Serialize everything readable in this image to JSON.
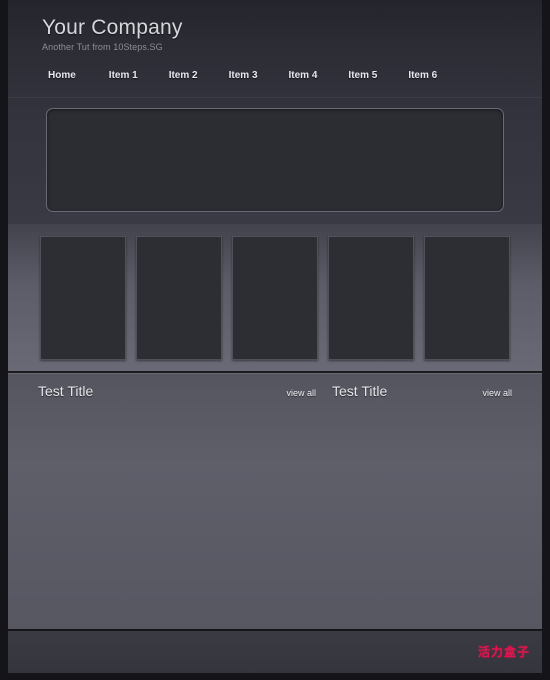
{
  "header": {
    "brand_title": "Your Company",
    "brand_tagline": "Another Tut from 10Steps.SG"
  },
  "nav": {
    "items": [
      {
        "label": "Home"
      },
      {
        "label": "Item 1"
      },
      {
        "label": "Item 2"
      },
      {
        "label": "Item 3"
      },
      {
        "label": "Item 4"
      },
      {
        "label": "Item 5"
      },
      {
        "label": "Item 6"
      }
    ]
  },
  "hero": {
    "placeholder_label": ""
  },
  "thumbnails": [
    {
      "label": ""
    },
    {
      "label": ""
    },
    {
      "label": ""
    },
    {
      "label": ""
    },
    {
      "label": ""
    }
  ],
  "panels": [
    {
      "title": "Test Title",
      "view_all_label": "view all",
      "body": ""
    },
    {
      "title": "Test Title",
      "view_all_label": "view all",
      "body": ""
    }
  ],
  "footer": {
    "watermark": "活力盒子"
  },
  "colors": {
    "header_bg": "#2c2c35",
    "hero_bg": "#32323c",
    "thumbs_bg": "#5c5c68",
    "content_bg": "#5f5f6a",
    "footer_bg": "#3b3b44",
    "placeholder_box": "#2e2e35",
    "text_primary": "#e4e4ea",
    "text_muted": "#8d8d99",
    "watermark_accent": "#e8124f"
  }
}
